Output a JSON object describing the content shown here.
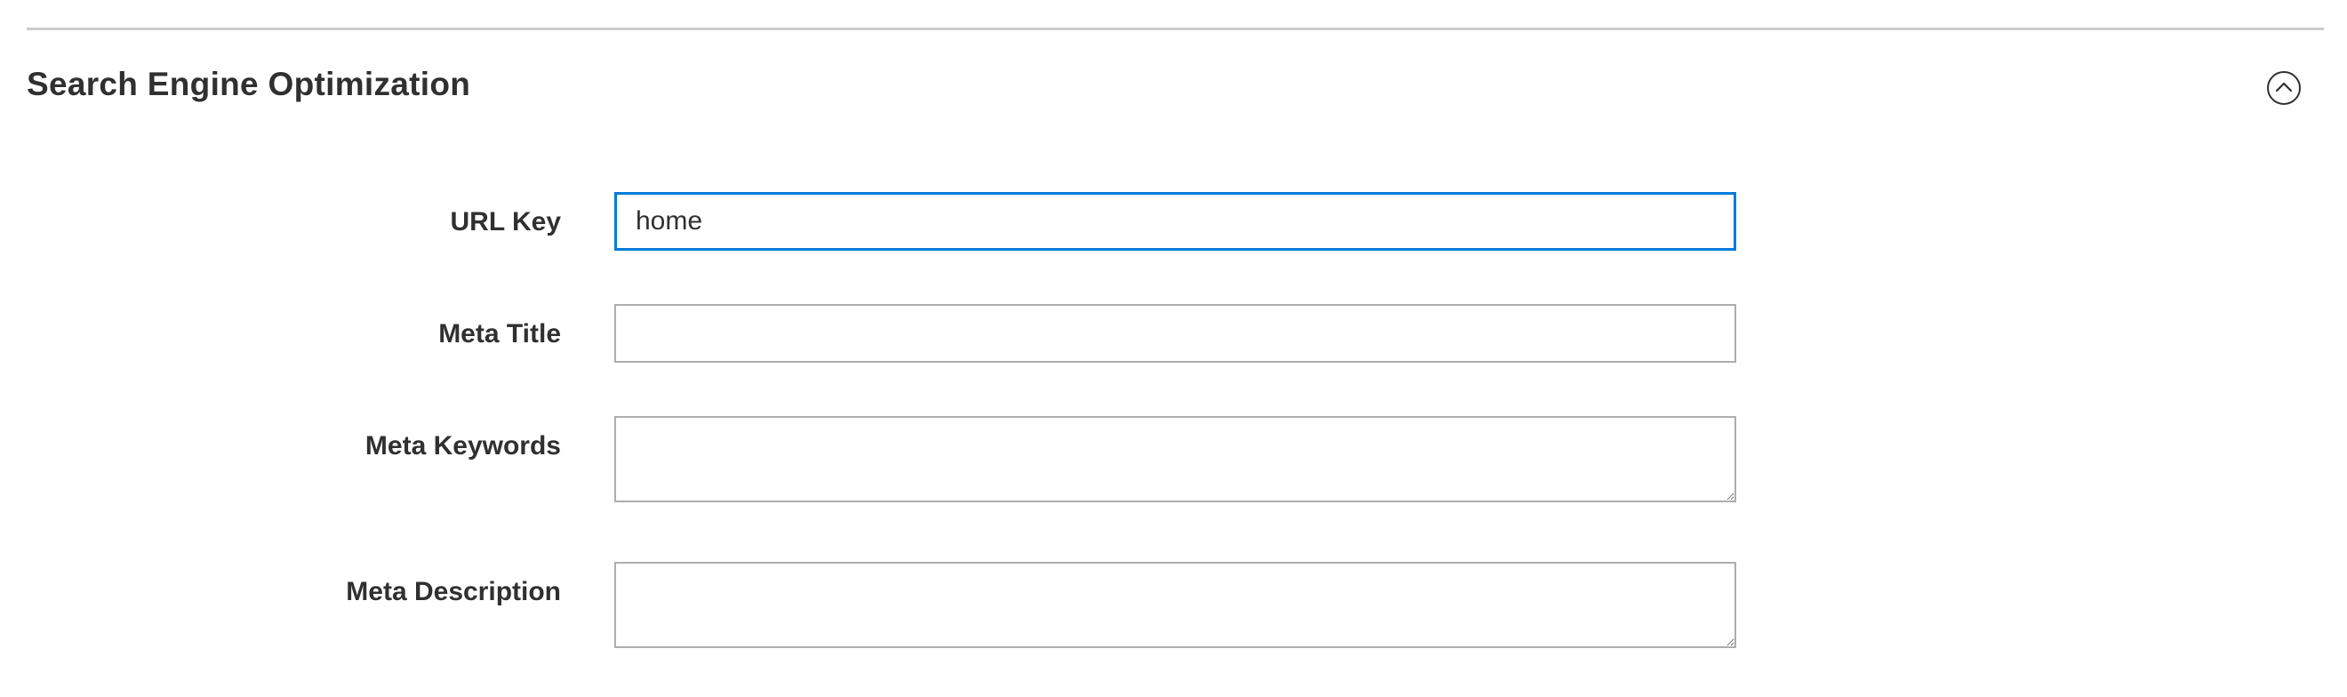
{
  "section": {
    "title": "Search Engine Optimization",
    "toggle_icon": "chevron-up-circle-icon"
  },
  "fields": {
    "url_key": {
      "label": "URL Key",
      "value": "home"
    },
    "meta_title": {
      "label": "Meta Title",
      "value": ""
    },
    "meta_keywords": {
      "label": "Meta Keywords",
      "value": ""
    },
    "meta_description": {
      "label": "Meta Description",
      "value": ""
    }
  },
  "colors": {
    "focus_border": "#007bdb",
    "input_border": "#adadad",
    "text": "#303030",
    "divider": "#cccccc"
  }
}
